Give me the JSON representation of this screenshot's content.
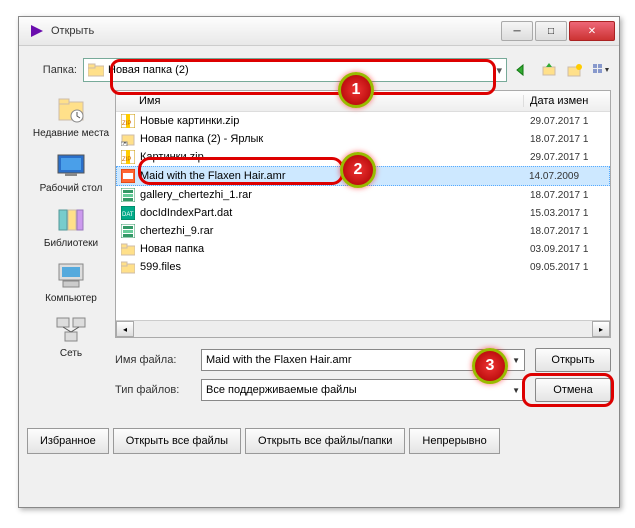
{
  "window": {
    "title": "Открыть"
  },
  "folder": {
    "label": "Папка:",
    "value": "Новая папка (2)"
  },
  "columns": {
    "name": "Имя",
    "date": "Дата измен"
  },
  "files": [
    {
      "icon": "zip",
      "name": "Новые картинки.zip",
      "date": "29.07.2017 1"
    },
    {
      "icon": "shortcut",
      "name": "Новая папка (2) - Ярлык",
      "date": "18.07.2017 1"
    },
    {
      "icon": "zip",
      "name": "Картинки.zip",
      "date": "29.07.2017 1"
    },
    {
      "icon": "amr",
      "name": "Maid with the Flaxen Hair.amr",
      "date": "14.07.2009",
      "selected": true
    },
    {
      "icon": "rar",
      "name": "gallery_chertezhi_1.rar",
      "date": "18.07.2017 1"
    },
    {
      "icon": "dat",
      "name": "docIdIndexPart.dat",
      "date": "15.03.2017 1"
    },
    {
      "icon": "rar",
      "name": "chertezhi_9.rar",
      "date": "18.07.2017 1"
    },
    {
      "icon": "folder",
      "name": "Новая папка",
      "date": "03.09.2017 1"
    },
    {
      "icon": "folder",
      "name": "599.files",
      "date": "09.05.2017 1"
    }
  ],
  "sidebar": [
    {
      "label": "Недавние места"
    },
    {
      "label": "Рабочий стол"
    },
    {
      "label": "Библиотеки"
    },
    {
      "label": "Компьютер"
    },
    {
      "label": "Сеть"
    }
  ],
  "filename": {
    "label": "Имя файла:",
    "value": "Maid with the Flaxen Hair.amr"
  },
  "filetype": {
    "label": "Тип файлов:",
    "value": "Все поддерживаемые файлы"
  },
  "buttons": {
    "open": "Открыть",
    "cancel": "Отмена",
    "favorites": "Избранное",
    "openall": "Открыть все файлы",
    "openallf": "Открыть все файлы/папки",
    "continuous": "Непрерывно"
  },
  "callouts": {
    "one": "1",
    "two": "2",
    "three": "3"
  }
}
